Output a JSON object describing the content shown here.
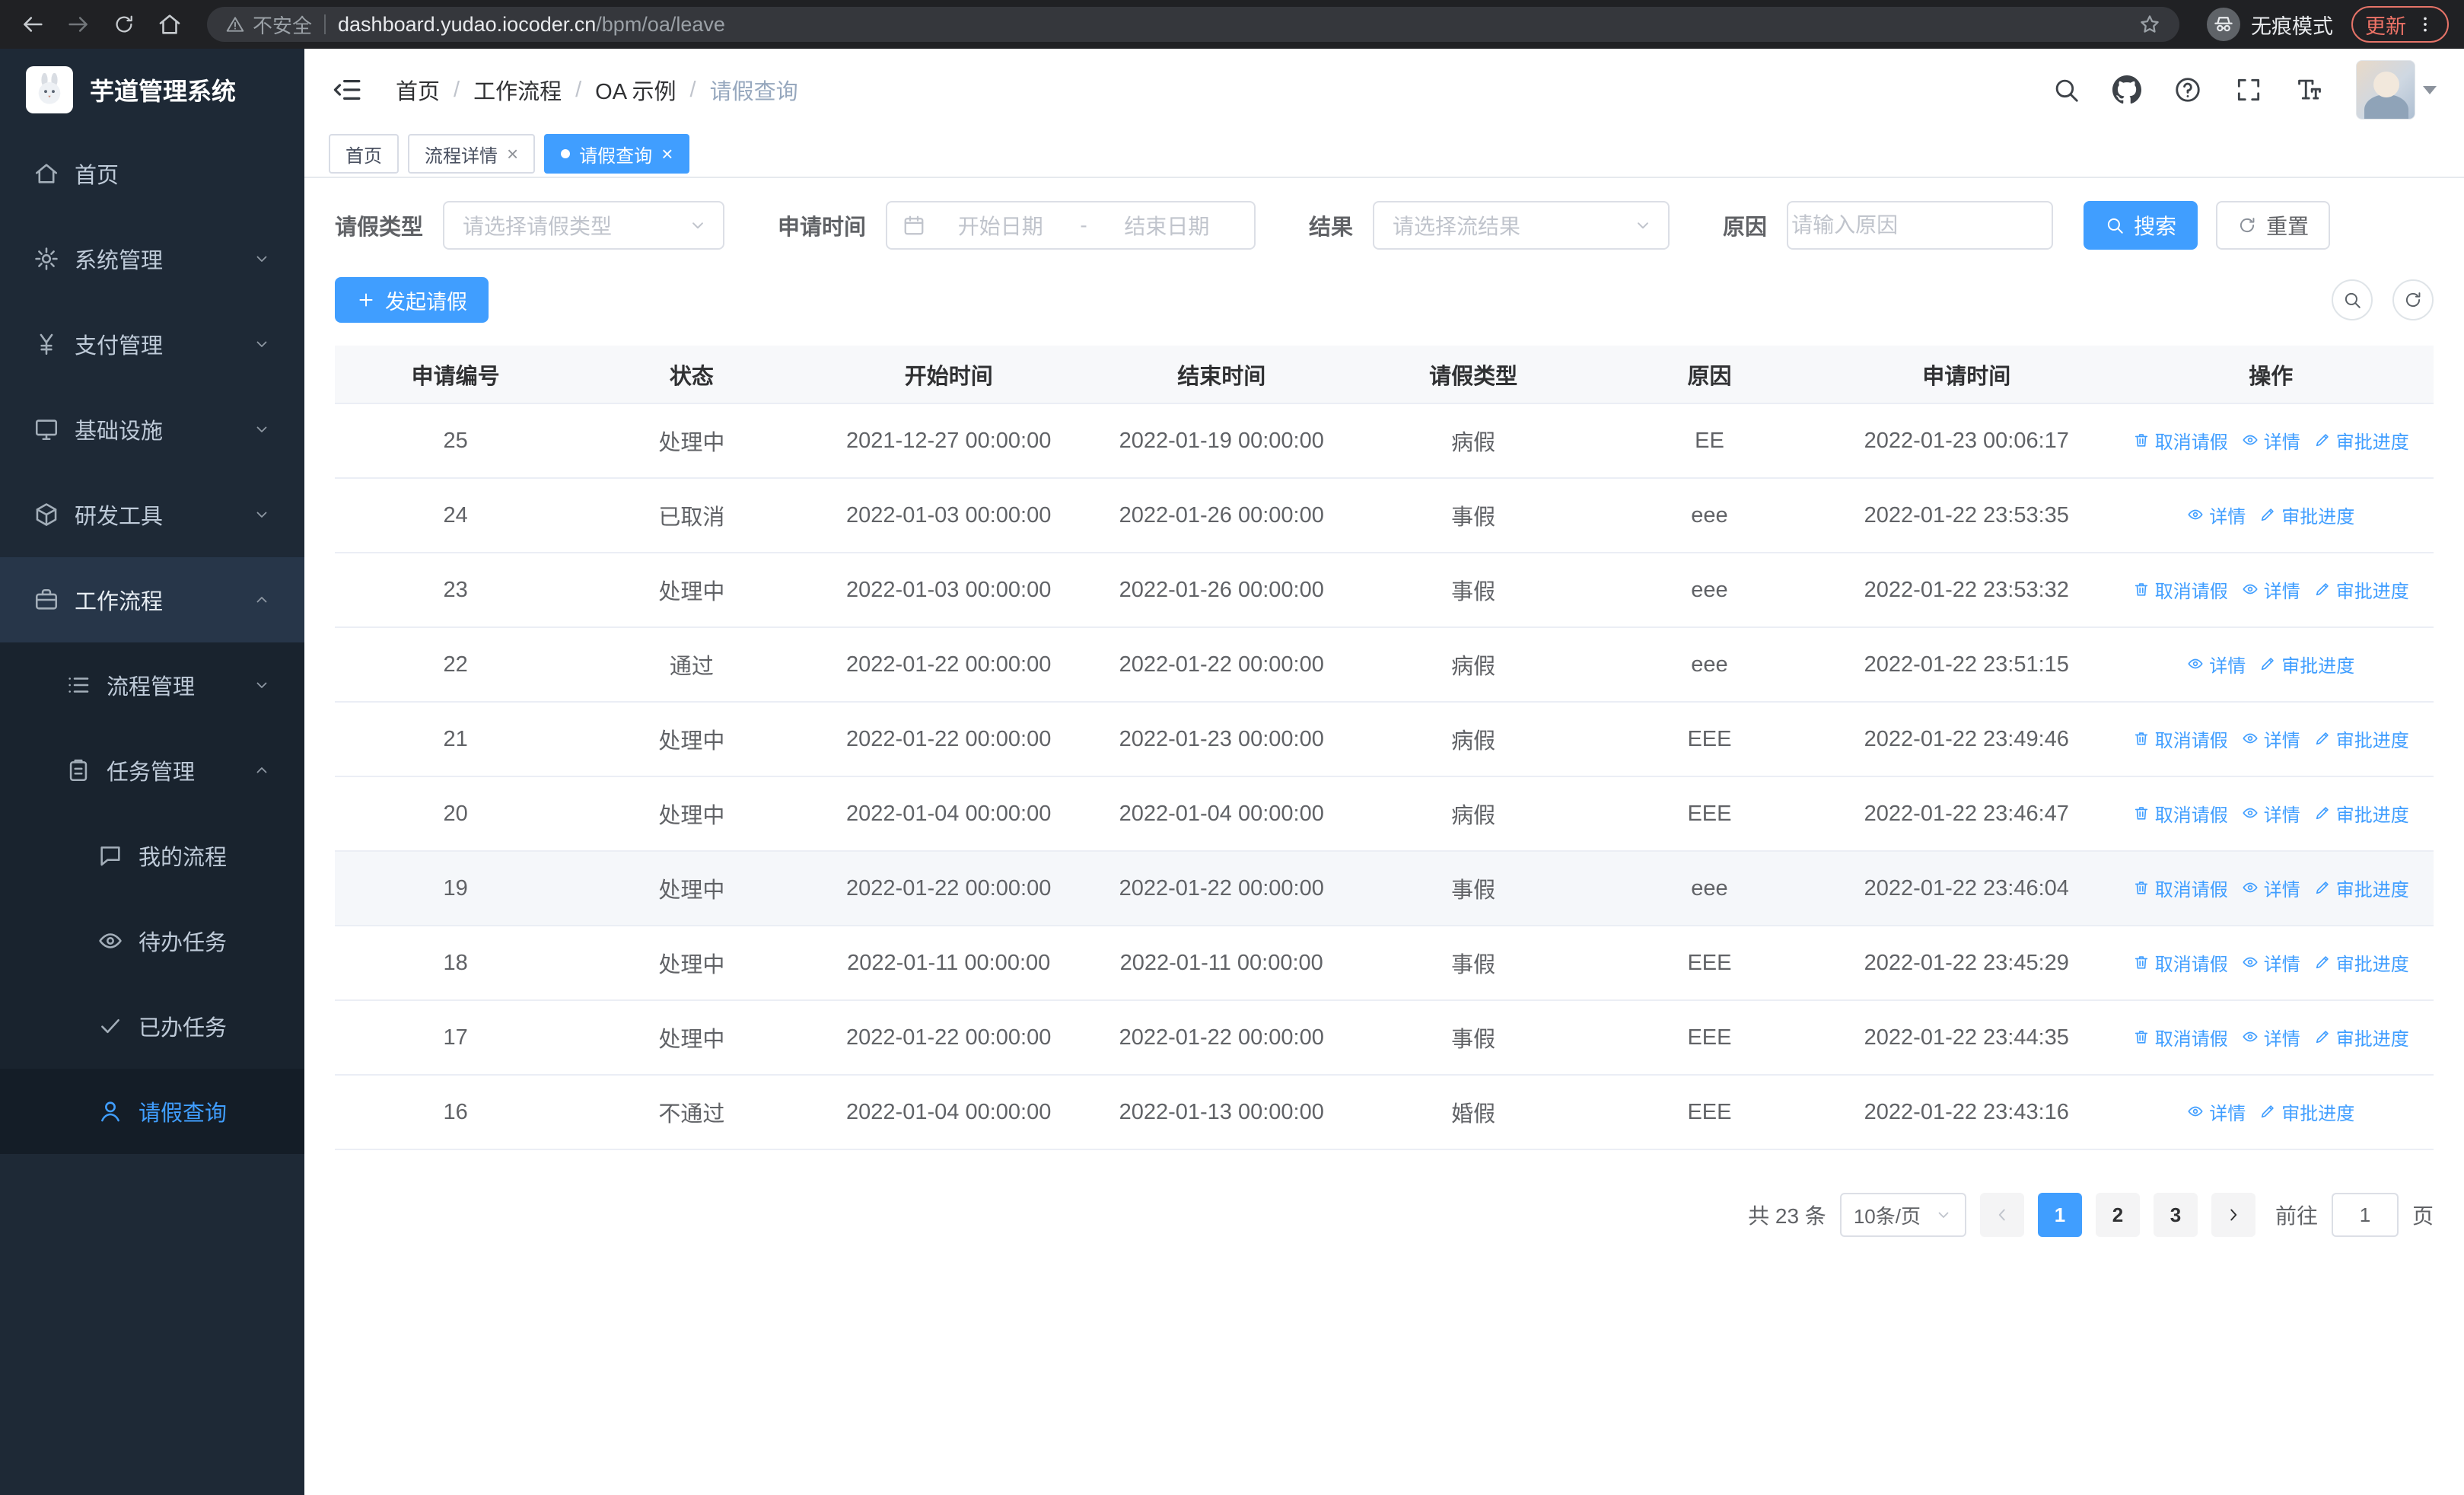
{
  "colors": {
    "primary": "#409eff",
    "sidebar_bg": "#1e2936",
    "chrome_bg": "#202124"
  },
  "browser": {
    "security_label": "不安全",
    "url_domain": "dashboard.yudao.iocoder.cn",
    "url_path": "/bpm/oa/leave",
    "incognito_label": "无痕模式",
    "update_label": "更新"
  },
  "sidebar": {
    "logo_title": "芋道管理系统",
    "items": [
      {
        "key": "home",
        "label": "首页",
        "icon": "home",
        "level": 1
      },
      {
        "key": "system",
        "label": "系统管理",
        "icon": "gear",
        "level": 1,
        "chevron": "down"
      },
      {
        "key": "payment",
        "label": "支付管理",
        "icon": "yen",
        "level": 1,
        "chevron": "down"
      },
      {
        "key": "infrastructure",
        "label": "基础设施",
        "icon": "monitor",
        "level": 1,
        "chevron": "down"
      },
      {
        "key": "devtools",
        "label": "研发工具",
        "icon": "cube",
        "level": 1,
        "chevron": "down"
      },
      {
        "key": "workflow",
        "label": "工作流程",
        "icon": "briefcase",
        "level": 1,
        "chevron": "up",
        "parent": true
      },
      {
        "key": "process-management",
        "label": "流程管理",
        "icon": "list",
        "level": 2,
        "chevron": "down"
      },
      {
        "key": "task-management",
        "label": "任务管理",
        "icon": "clipboard",
        "level": 2,
        "chevron": "up"
      },
      {
        "key": "my-process",
        "label": "我的流程",
        "icon": "chat",
        "level": 3
      },
      {
        "key": "todo-tasks",
        "label": "待办任务",
        "icon": "eye",
        "level": 3
      },
      {
        "key": "done-tasks",
        "label": "已办任务",
        "icon": "check",
        "level": 3
      },
      {
        "key": "leave-query",
        "label": "请假查询",
        "icon": "user",
        "level": 3,
        "active": true
      }
    ]
  },
  "header": {
    "breadcrumb": [
      "首页",
      "工作流程",
      "OA 示例",
      "请假查询"
    ]
  },
  "tabs": [
    {
      "key": "home",
      "label": "首页",
      "closable": false,
      "active": false
    },
    {
      "key": "process-detail",
      "label": "流程详情",
      "closable": true,
      "active": false
    },
    {
      "key": "leave-query",
      "label": "请假查询",
      "closable": true,
      "active": true
    }
  ],
  "filters": {
    "leave_type_label": "请假类型",
    "leave_type_placeholder": "请选择请假类型",
    "apply_time_label": "申请时间",
    "start_date_placeholder": "开始日期",
    "range_separator": "-",
    "end_date_placeholder": "结束日期",
    "result_label": "结果",
    "result_placeholder": "请选择流结果",
    "reason_label": "原因",
    "reason_placeholder": "请输入原因",
    "search_button": "搜索",
    "reset_button": "重置"
  },
  "toolbar": {
    "create_button": "发起请假"
  },
  "table": {
    "columns": [
      "申请编号",
      "状态",
      "开始时间",
      "结束时间",
      "请假类型",
      "原因",
      "申请时间",
      "操作"
    ],
    "action_labels": {
      "cancel": "取消请假",
      "detail": "详情",
      "progress": "审批进度"
    },
    "rows": [
      {
        "id": "25",
        "status": "处理中",
        "start": "2021-12-27 00:00:00",
        "end": "2022-01-19 00:00:00",
        "type": "病假",
        "reason": "EE",
        "apply_time": "2022-01-23 00:06:17",
        "actions": [
          "cancel",
          "detail",
          "progress"
        ]
      },
      {
        "id": "24",
        "status": "已取消",
        "start": "2022-01-03 00:00:00",
        "end": "2022-01-26 00:00:00",
        "type": "事假",
        "reason": "eee",
        "apply_time": "2022-01-22 23:53:35",
        "actions": [
          "detail",
          "progress"
        ]
      },
      {
        "id": "23",
        "status": "处理中",
        "start": "2022-01-03 00:00:00",
        "end": "2022-01-26 00:00:00",
        "type": "事假",
        "reason": "eee",
        "apply_time": "2022-01-22 23:53:32",
        "actions": [
          "cancel",
          "detail",
          "progress"
        ]
      },
      {
        "id": "22",
        "status": "通过",
        "start": "2022-01-22 00:00:00",
        "end": "2022-01-22 00:00:00",
        "type": "病假",
        "reason": "eee",
        "apply_time": "2022-01-22 23:51:15",
        "actions": [
          "detail",
          "progress"
        ]
      },
      {
        "id": "21",
        "status": "处理中",
        "start": "2022-01-22 00:00:00",
        "end": "2022-01-23 00:00:00",
        "type": "病假",
        "reason": "EEE",
        "apply_time": "2022-01-22 23:49:46",
        "actions": [
          "cancel",
          "detail",
          "progress"
        ]
      },
      {
        "id": "20",
        "status": "处理中",
        "start": "2022-01-04 00:00:00",
        "end": "2022-01-04 00:00:00",
        "type": "病假",
        "reason": "EEE",
        "apply_time": "2022-01-22 23:46:47",
        "actions": [
          "cancel",
          "detail",
          "progress"
        ]
      },
      {
        "id": "19",
        "status": "处理中",
        "start": "2022-01-22 00:00:00",
        "end": "2022-01-22 00:00:00",
        "type": "事假",
        "reason": "eee",
        "apply_time": "2022-01-22 23:46:04",
        "actions": [
          "cancel",
          "detail",
          "progress"
        ],
        "highlighted": true
      },
      {
        "id": "18",
        "status": "处理中",
        "start": "2022-01-11 00:00:00",
        "end": "2022-01-11 00:00:00",
        "type": "事假",
        "reason": "EEE",
        "apply_time": "2022-01-22 23:45:29",
        "actions": [
          "cancel",
          "detail",
          "progress"
        ]
      },
      {
        "id": "17",
        "status": "处理中",
        "start": "2022-01-22 00:00:00",
        "end": "2022-01-22 00:00:00",
        "type": "事假",
        "reason": "EEE",
        "apply_time": "2022-01-22 23:44:35",
        "actions": [
          "cancel",
          "detail",
          "progress"
        ]
      },
      {
        "id": "16",
        "status": "不通过",
        "start": "2022-01-04 00:00:00",
        "end": "2022-01-13 00:00:00",
        "type": "婚假",
        "reason": "EEE",
        "apply_time": "2022-01-22 23:43:16",
        "actions": [
          "detail",
          "progress"
        ]
      }
    ]
  },
  "pagination": {
    "total_label": "共 23 条",
    "page_size_label": "10条/页",
    "pages": [
      "1",
      "2",
      "3"
    ],
    "active_page": "1",
    "goto_label": "前往",
    "goto_value": "1",
    "unit_label": "页"
  }
}
